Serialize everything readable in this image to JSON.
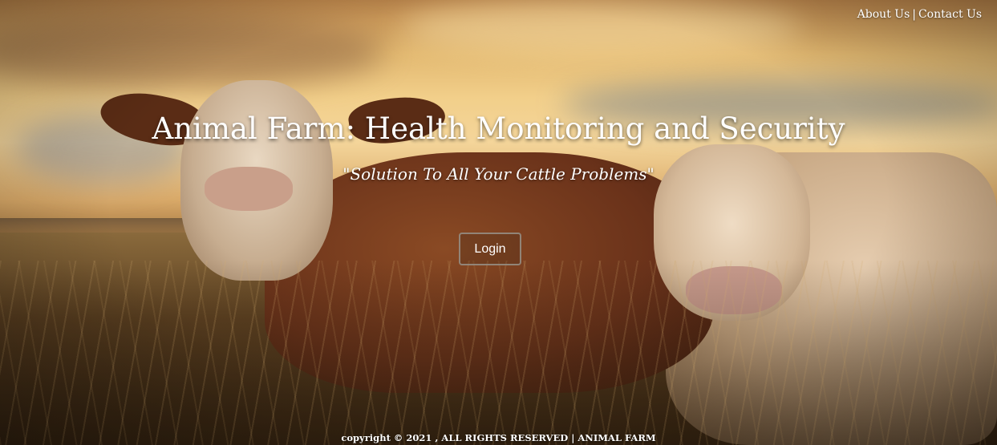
{
  "nav": {
    "about_label": "About Us",
    "separator": "|",
    "contact_label": "Contact Us"
  },
  "hero": {
    "title": "Animal Farm: Health Monitoring and Security",
    "subtitle": "\"Solution To All Your Cattle Problems\"",
    "login_label": "Login"
  },
  "footer": {
    "text": "copyright © 2021 , ALL RIGHTS RESERVED | ANIMAL FARM"
  },
  "colors": {
    "text": "#ffffff",
    "button_border": "#968c82",
    "sky": "#f2cf8a",
    "field": "#5e4222"
  },
  "background": {
    "icon": "cattle-field-photo"
  }
}
